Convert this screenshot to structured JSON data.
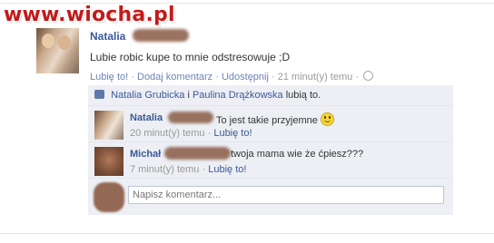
{
  "watermark": "www.wiocha.pl",
  "post": {
    "author": "Natalia",
    "text": "Lubie robic kupe to mnie odstresowuje ;D",
    "actions": {
      "like": "Lubię to!",
      "comment": "Dodaj komentarz",
      "share": "Udostępnij",
      "time": "21 minut(y) temu"
    }
  },
  "likes": {
    "name1": "Natalia Grubicka",
    "joiner": "i",
    "name2": "Paulina Drążkowska",
    "suffix": "lubią to."
  },
  "comments": [
    {
      "author": "Natalia",
      "text": "To jest takie przyjemne",
      "time": "20 minut(y) temu",
      "like": "Lubię to!"
    },
    {
      "author": "Michał",
      "text": "twoja mama wie że ćpiesz???",
      "time": "7 minut(y) temu",
      "like": "Lubię to!"
    }
  ],
  "composer": {
    "placeholder": "Napisz komentarz..."
  },
  "icons": {
    "like": "thumbs-up-icon",
    "privacy": "globe-icon",
    "emoticon": "smiley-icon"
  },
  "colors": {
    "link": "#3b5998",
    "panel": "#edeff4",
    "watermark": "#c21b1b"
  }
}
